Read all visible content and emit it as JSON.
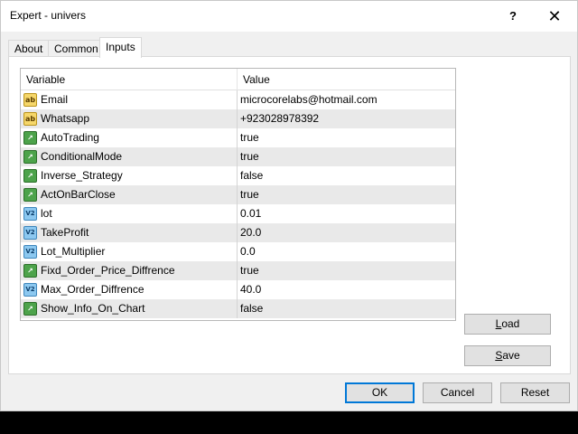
{
  "window": {
    "title": "Expert - univers",
    "help_glyph": "?",
    "close_glyph": "✕"
  },
  "tabs": [
    {
      "label": "About"
    },
    {
      "label": "Common"
    },
    {
      "label": "Inputs",
      "active": true
    }
  ],
  "grid": {
    "headers": {
      "variable": "Variable",
      "value": "Value"
    },
    "rows": [
      {
        "name": "Email",
        "value": "microcorelabs@hotmail.com",
        "icon": "string-icon"
      },
      {
        "name": "Whatsapp",
        "value": "+923028978392",
        "icon": "string-icon"
      },
      {
        "name": "AutoTrading",
        "value": "true",
        "icon": "boolean-icon"
      },
      {
        "name": "ConditionalMode",
        "value": "true",
        "icon": "boolean-icon"
      },
      {
        "name": "Inverse_Strategy",
        "value": "false",
        "icon": "boolean-icon"
      },
      {
        "name": "ActOnBarClose",
        "value": "true",
        "icon": "boolean-icon"
      },
      {
        "name": "lot",
        "value": "0.01",
        "icon": "number-icon"
      },
      {
        "name": "TakeProfit",
        "value": "20.0",
        "icon": "number-icon"
      },
      {
        "name": "Lot_Multiplier",
        "value": "0.0",
        "icon": "number-icon"
      },
      {
        "name": "Fixd_Order_Price_Diffrence",
        "value": "true",
        "icon": "boolean-icon"
      },
      {
        "name": "Max_Order_Diffrence",
        "value": "40.0",
        "icon": "number-icon"
      },
      {
        "name": "Show_Info_On_Chart",
        "value": "false",
        "icon": "boolean-icon"
      }
    ]
  },
  "side_buttons": {
    "load_first": "L",
    "load_rest": "oad",
    "save_first": "S",
    "save_rest": "ave"
  },
  "footer": {
    "ok": "OK",
    "cancel": "Cancel",
    "reset": "Reset"
  },
  "colors": {
    "default_button_border": "#0078d7",
    "alt_row": "#e9e9e9"
  }
}
